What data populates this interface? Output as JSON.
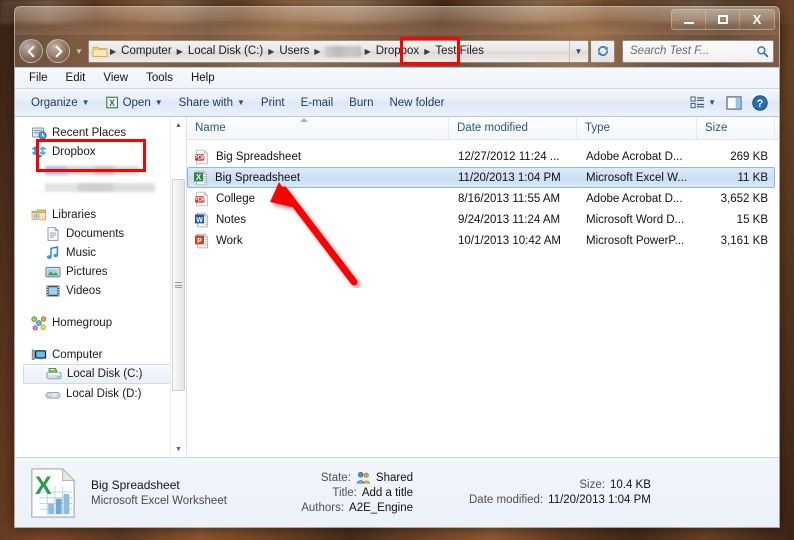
{
  "window": {
    "title": "",
    "controls": {
      "minimize": "minimize-button",
      "maximize": "maximize-button",
      "close": "X"
    }
  },
  "address_bar": {
    "back": "back-button",
    "forward": "forward-button",
    "history_dropdown": "▾",
    "breadcrumbs": [
      {
        "label": "Computer",
        "redacted": false
      },
      {
        "label": "Local Disk (C:)",
        "redacted": false
      },
      {
        "label": "Users",
        "redacted": false
      },
      {
        "label": "",
        "redacted": true
      },
      {
        "label": "Dropbox",
        "redacted": false,
        "highlighted": true
      },
      {
        "label": "Test Files",
        "redacted": false
      }
    ],
    "separator": "▶",
    "dropdown_caret": "▼",
    "refresh": "refresh-button"
  },
  "search": {
    "placeholder": "Search Test F...",
    "icon": "search-icon"
  },
  "menubar": {
    "items": [
      "File",
      "Edit",
      "View",
      "Tools",
      "Help"
    ]
  },
  "toolbar": {
    "items": [
      {
        "label": "Organize",
        "has_caret": true,
        "icon": null
      },
      {
        "label": "Open",
        "has_caret": true,
        "icon": "excel-icon"
      },
      {
        "label": "Share with",
        "has_caret": true,
        "icon": null
      },
      {
        "label": "Print",
        "has_caret": false,
        "icon": null
      },
      {
        "label": "E-mail",
        "has_caret": false,
        "icon": null
      },
      {
        "label": "Burn",
        "has_caret": false,
        "icon": null
      },
      {
        "label": "New folder",
        "has_caret": false,
        "icon": null
      }
    ],
    "right_icons": [
      {
        "name": "change-view-icon",
        "caret": "▼"
      },
      {
        "name": "preview-pane-icon",
        "caret": ""
      },
      {
        "name": "help-icon",
        "caret": ""
      }
    ]
  },
  "nav_pane": {
    "items": [
      {
        "label": "Recent Places",
        "icon": "recent-places-icon",
        "indent": false,
        "selected": false
      },
      {
        "label": "Dropbox",
        "icon": "dropbox-icon",
        "indent": false,
        "selected": false,
        "highlighted": true
      },
      {
        "label": "",
        "icon": "redacted",
        "indent": true,
        "redacted": true
      },
      {
        "label": "Libraries",
        "icon": "libraries-icon",
        "indent": false,
        "selected": false,
        "gap_before": true
      },
      {
        "label": "Documents",
        "icon": "documents-icon",
        "indent": true,
        "selected": false
      },
      {
        "label": "Music",
        "icon": "music-icon",
        "indent": true,
        "selected": false
      },
      {
        "label": "Pictures",
        "icon": "pictures-icon",
        "indent": true,
        "selected": false
      },
      {
        "label": "Videos",
        "icon": "videos-icon",
        "indent": true,
        "selected": false
      },
      {
        "label": "Homegroup",
        "icon": "homegroup-icon",
        "indent": false,
        "selected": false,
        "gap_before": true
      },
      {
        "label": "Computer",
        "icon": "computer-icon",
        "indent": false,
        "selected": false,
        "gap_before": true
      },
      {
        "label": "Local Disk (C:)",
        "icon": "local-disk-c-icon",
        "indent": true,
        "selected": true
      },
      {
        "label": "Local Disk (D:)",
        "icon": "local-disk-d-icon",
        "indent": true,
        "selected": false
      }
    ],
    "scrollbar": {
      "up_arrow": "▲",
      "down_arrow": "▼"
    }
  },
  "file_list": {
    "columns": [
      "Name",
      "Date modified",
      "Type",
      "Size"
    ],
    "sort_column": "Name",
    "sort_direction": "ascending",
    "rows": [
      {
        "name": "Big Spreadsheet",
        "date_modified": "12/27/2012 11:24 ...",
        "type": "Adobe Acrobat D...",
        "size": "269 KB",
        "icon": "pdf-icon",
        "selected": false
      },
      {
        "name": "Big Spreadsheet",
        "date_modified": "11/20/2013 1:04 PM",
        "type": "Microsoft Excel W...",
        "size": "11 KB",
        "icon": "excel-icon",
        "selected": true
      },
      {
        "name": "College",
        "date_modified": "8/16/2013 11:55 AM",
        "type": "Adobe Acrobat D...",
        "size": "3,652 KB",
        "icon": "pdf-icon",
        "selected": false
      },
      {
        "name": "Notes",
        "date_modified": "9/24/2013 11:24 AM",
        "type": "Microsoft Word D...",
        "size": "15 KB",
        "icon": "word-icon",
        "selected": false
      },
      {
        "name": "Work",
        "date_modified": "10/1/2013 10:42 AM",
        "type": "Microsoft PowerP...",
        "size": "3,161 KB",
        "icon": "powerpoint-icon",
        "selected": false
      }
    ]
  },
  "details_pane": {
    "icon": "excel-document-icon",
    "name": "Big Spreadsheet",
    "kind": "Microsoft Excel Worksheet",
    "fields": [
      {
        "label": "State:",
        "value": "Shared",
        "icon": "shared-users-icon"
      },
      {
        "label": "Title:",
        "value": "Add a title",
        "icon": null
      },
      {
        "label": "Authors:",
        "value": "A2E_Engine",
        "icon": null
      },
      {
        "label": "Size:",
        "value": "10.4 KB",
        "icon": null
      },
      {
        "label": "Date modified:",
        "value": "11/20/2013 1:04 PM",
        "icon": null
      }
    ]
  },
  "annotations": {
    "color": "#fe0000",
    "boxes": [
      "breadcrumb-dropbox",
      "sidebar-dropbox"
    ],
    "arrow": "points-to-selected-excel-file"
  }
}
